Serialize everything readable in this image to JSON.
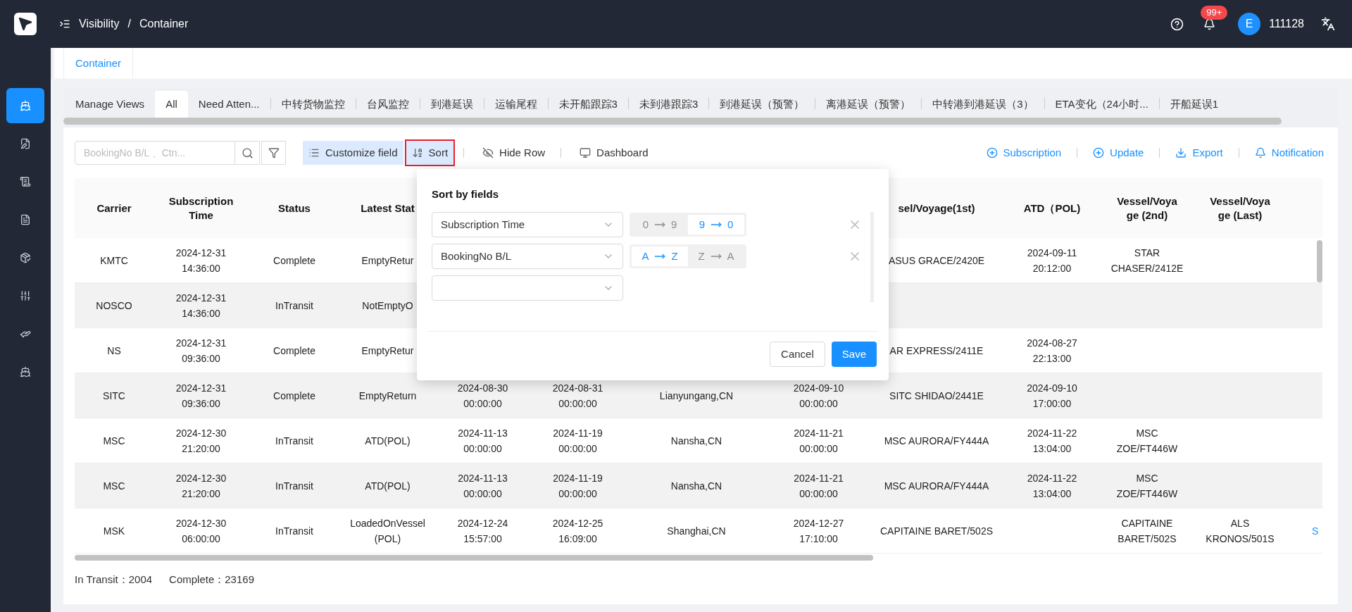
{
  "header": {
    "breadcrumb": [
      "Visibility",
      "Container"
    ],
    "breadcrumb_separator": "/",
    "notification_count": "99+",
    "avatar_initial": "E",
    "user": "111128"
  },
  "sidebar": {
    "items": [
      {
        "selected": true
      },
      {
        "selected": false
      },
      {
        "selected": false
      },
      {
        "selected": false
      },
      {
        "selected": false
      },
      {
        "selected": false
      },
      {
        "selected": false
      },
      {
        "selected": false
      }
    ]
  },
  "page_tabs": [
    {
      "label": "Container",
      "selected": true
    }
  ],
  "views": [
    {
      "label": "Manage Views",
      "selected": false
    },
    {
      "label": "All",
      "selected": true
    },
    {
      "label": "Need Atten...",
      "selected": false
    },
    {
      "label": "中转货物监控",
      "selected": false
    },
    {
      "label": "台风监控",
      "selected": false
    },
    {
      "label": "到港延误",
      "selected": false
    },
    {
      "label": "运输尾程",
      "selected": false
    },
    {
      "label": "未开船跟踪3",
      "selected": false
    },
    {
      "label": "未到港跟踪3",
      "selected": false
    },
    {
      "label": "到港延误（预警）",
      "selected": false
    },
    {
      "label": "离港延误（预警）",
      "selected": false
    },
    {
      "label": "中转港到港延误（3）",
      "selected": false
    },
    {
      "label": "ETA变化（24小时...",
      "selected": false
    },
    {
      "label": "开船延误1",
      "selected": false
    }
  ],
  "search": {
    "placeholder": "BookingNo B/L 、Ctn..."
  },
  "toolbar_left": [
    {
      "label": "Customize field",
      "active": true,
      "highlighted": false
    },
    {
      "label": "Sort",
      "active": true,
      "highlighted": true
    },
    {
      "label": "Hide Row",
      "active": false,
      "highlighted": false
    },
    {
      "label": "Dashboard",
      "active": false,
      "highlighted": false
    }
  ],
  "toolbar_right": [
    {
      "label": "Subscription"
    },
    {
      "label": "Update"
    },
    {
      "label": "Export"
    },
    {
      "label": "Notification"
    }
  ],
  "table": {
    "columns": [
      "Carrier",
      "Subscription Time",
      "Status",
      "Latest Stat",
      null,
      null,
      null,
      null,
      "sel/Voyage(1st)",
      "ATD（POL)",
      "Vessel/Voyage (2nd)",
      "Vessel/Voyage (Last)",
      null
    ],
    "rows": [
      [
        "KMTC",
        "2024-12-31 14:36:00",
        "Complete",
        "EmptyRetur",
        null,
        null,
        null,
        null,
        "ASUS GRACE/2420E",
        "2024-09-11 20:12:00",
        "STAR CHASER/2412E",
        null,
        null
      ],
      [
        "NOSCO",
        "2024-12-31 14:36:00",
        "InTransit",
        "NotEmptyO",
        null,
        null,
        null,
        null,
        null,
        null,
        null,
        null,
        null
      ],
      [
        "NS",
        "2024-12-31 09:36:00",
        "Complete",
        "EmptyRetur",
        null,
        null,
        null,
        null,
        "AR EXPRESS/2411E",
        "2024-08-27 22:13:00",
        null,
        null,
        null
      ],
      [
        "SITC",
        "2024-12-31 09:36:00",
        "Complete",
        "EmptyReturn",
        "2024-08-30 00:00:00",
        "2024-08-31 00:00:00",
        "Lianyungang,CN",
        "2024-09-10 00:00:00",
        "SITC SHIDAO/2441E",
        "2024-09-10 17:00:00",
        null,
        null,
        null
      ],
      [
        "MSC",
        "2024-12-30 21:20:00",
        "InTransit",
        "ATD(POL)",
        "2024-11-13 00:00:00",
        "2024-11-19 00:00:00",
        "Nansha,CN",
        "2024-11-21 00:00:00",
        "MSC AURORA/FY444A",
        "2024-11-22 13:04:00",
        "MSC ZOE/FT446W",
        null,
        null
      ],
      [
        "MSC",
        "2024-12-30 21:20:00",
        "InTransit",
        "ATD(POL)",
        "2024-11-13 00:00:00",
        "2024-11-19 00:00:00",
        "Nansha,CN",
        "2024-11-21 00:00:00",
        "MSC AURORA/FY444A",
        "2024-11-22 13:04:00",
        "MSC ZOE/FT446W",
        null,
        null
      ],
      [
        "MSK",
        "2024-12-30 06:00:00",
        "InTransit",
        "LoadedOnVessel (POL)",
        "2024-12-24 15:57:00",
        "2024-12-25 16:09:00",
        "Shanghai,CN",
        "2024-12-27 17:10:00",
        "CAPITAINE BARET/502S",
        null,
        "CAPITAINE BARET/502S",
        "ALS KRONOS/501S",
        "S"
      ]
    ]
  },
  "summary": [
    "In Transit：2004",
    "Complete：23169"
  ],
  "sort_popup": {
    "title": "Sort by fields",
    "rules": [
      {
        "field": "Subscription Time",
        "removable": true,
        "orders": [
          {
            "from": "0",
            "to": "9",
            "selected": false
          },
          {
            "from": "9",
            "to": "0",
            "selected": true
          }
        ]
      },
      {
        "field": "BookingNo B/L",
        "removable": true,
        "orders": [
          {
            "from": "A",
            "to": "Z",
            "selected": true
          },
          {
            "from": "Z",
            "to": "A",
            "selected": false
          }
        ]
      },
      {
        "removable": false
      }
    ],
    "buttons": [
      {
        "label": "Cancel",
        "kind": "default"
      },
      {
        "label": "Save",
        "kind": "primary"
      }
    ]
  }
}
